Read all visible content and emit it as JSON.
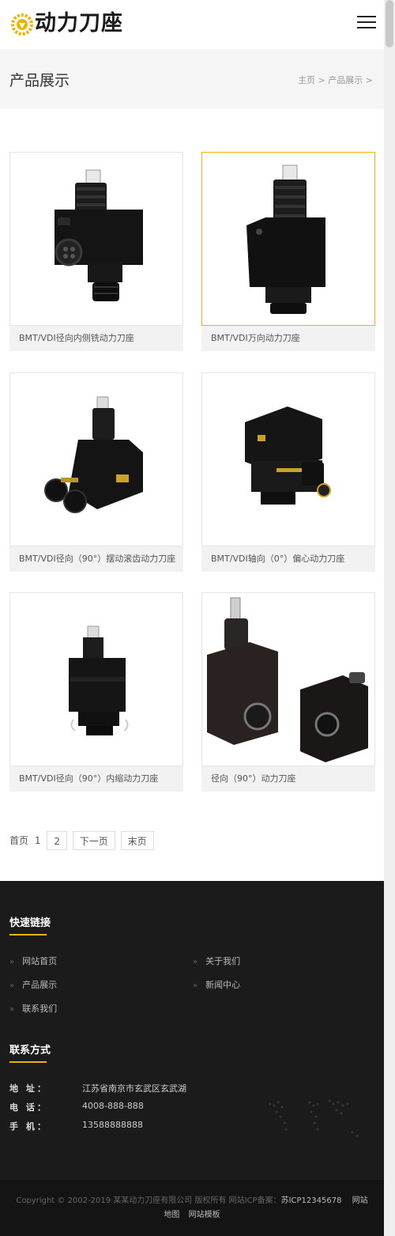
{
  "brand": {
    "name": "动力刀座",
    "accent": "#f0b400"
  },
  "banner": {
    "title": "产品展示",
    "crumb_home": "主页",
    "crumb_sep": ">",
    "crumb_current": "产品展示",
    "crumb_tail": ">"
  },
  "products": [
    {
      "title": "BMT/VDI径向内侧铣动力刀座"
    },
    {
      "title": "BMT/VDI万向动力刀座"
    },
    {
      "title": "BMT/VDI径向（90°）摆动滚齿动力刀座"
    },
    {
      "title": "BMT/VDI轴向（0°）偏心动力刀座"
    },
    {
      "title": "BMT/VDI径向（90°）内缩动力刀座"
    },
    {
      "title": "径向（90°）动力刀座"
    }
  ],
  "pager": {
    "first": "首页",
    "current": "1",
    "page2": "2",
    "next": "下一页",
    "last": "末页"
  },
  "footer": {
    "links_title": "快速链接",
    "links": [
      "网站首页",
      "关于我们",
      "产品展示",
      "新闻中心",
      "联系我们"
    ],
    "contact_title": "联系方式",
    "address_label": "地 址：",
    "address": "江苏省南京市玄武区玄武湖",
    "phone_label": "电 话：",
    "phone": "4008-888-888",
    "mobile_label": "手 机：",
    "mobile": "13588888888"
  },
  "copyright": {
    "text": "Copyright © 2002-2019 某某动力刀座有限公司 版权所有  网站ICP备案：",
    "icp": "苏ICP12345678",
    "sitemap": "网站地图",
    "template": "网站模板"
  }
}
